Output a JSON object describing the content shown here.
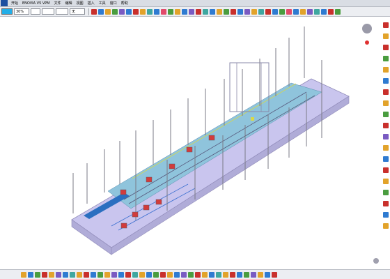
{
  "app": {
    "start_label": "开始",
    "window_title": "ENOVIA V5 VPM",
    "menu": [
      "文件",
      "编辑",
      "视图",
      "插入",
      "工具",
      "窗口",
      "帮助"
    ]
  },
  "toolbar": {
    "color_hex": "#22aee8",
    "zoom_value": "30%",
    "combo_2": "",
    "combo_3": "",
    "combo_4": "",
    "combo_5": "无"
  },
  "top_icons": [
    "#c9302c",
    "#2f7bd1",
    "#e2a32b",
    "#4a9d3f",
    "#7a5bc2",
    "#2f7bd1",
    "#c9302c",
    "#e2a32b",
    "#3fa7a0",
    "#2f7bd1",
    "#e24a6a",
    "#4a9d3f",
    "#e2a32b",
    "#2f7bd1",
    "#7a5bc2",
    "#c9302c",
    "#3fa7a0",
    "#2f7bd1",
    "#e2a32b",
    "#4a9d3f",
    "#c9302c",
    "#2f7bd1",
    "#7a5bc2",
    "#e2a32b",
    "#3fa7a0",
    "#c9302c",
    "#2f7bd1",
    "#4a9d3f",
    "#e24a6a",
    "#2f7bd1",
    "#e2a32b",
    "#7a5bc2",
    "#3fa7a0",
    "#2f7bd1",
    "#c9302c",
    "#4a9d3f"
  ],
  "right_icons": [
    "#c9302c",
    "#e2a32b",
    "#c9302c",
    "#4a9d3f",
    "#e2a32b",
    "#2f7bd1",
    "#c9302c",
    "#e2a32b",
    "#4a9d3f",
    "#c9302c",
    "#7a5bc2",
    "#e2a32b",
    "#2f7bd1",
    "#c9302c",
    "#e2a32b",
    "#4a9d3f",
    "#c9302c",
    "#2f7bd1",
    "#e2a32b"
  ],
  "bottom_icons": [
    "#e2a32b",
    "#2f7bd1",
    "#4a9d3f",
    "#c9302c",
    "#e2a32b",
    "#7a5bc2",
    "#2f7bd1",
    "#3fa7a0",
    "#e2a32b",
    "#c9302c",
    "#2f7bd1",
    "#4a9d3f",
    "#e2a32b",
    "#7a5bc2",
    "#2f7bd1",
    "#c9302c",
    "#3fa7a0",
    "#e2a32b",
    "#2f7bd1",
    "#4a9d3f",
    "#c9302c",
    "#e2a32b",
    "#2f7bd1",
    "#7a5bc2",
    "#4a9d3f",
    "#c9302c",
    "#e2a32b",
    "#2f7bd1",
    "#3fa7a0",
    "#e2a32b",
    "#c9302c",
    "#2f7bd1",
    "#4a9d3f",
    "#7a5bc2",
    "#e2a32b",
    "#2f7bd1",
    "#c9302c"
  ],
  "scene": {
    "floor_top": "#c9c5ee",
    "floor_side": "#b0acd8",
    "floor_edge": "#8f8ab8",
    "strip": "#8fc4dc",
    "strip_dark": "#2a6fc0",
    "pole": "#7a7a86",
    "guide_line": "#d8d84a",
    "robot": "#d23b3b",
    "gantry": "#8a88a8",
    "compass": "#9a9aa8",
    "compass_dot": "#e03030"
  }
}
